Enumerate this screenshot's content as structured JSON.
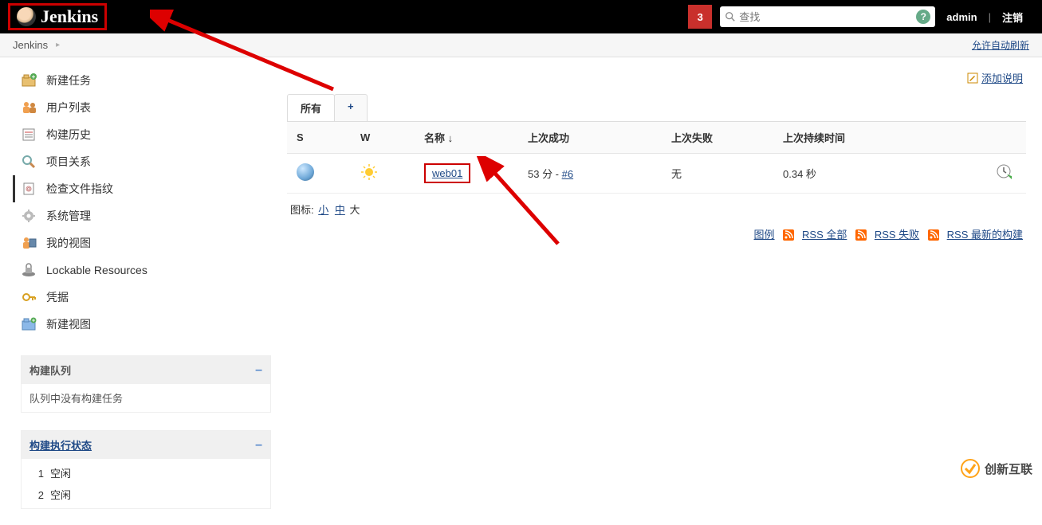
{
  "header": {
    "logo_text": "Jenkins",
    "notification_count": "3",
    "search_placeholder": "查找",
    "username": "admin",
    "logout": "注销"
  },
  "breadcrumb": {
    "root": "Jenkins",
    "auto_refresh": "允许自动刷新"
  },
  "sidebar": {
    "items": [
      {
        "key": "new-item",
        "label": "新建任务"
      },
      {
        "key": "people",
        "label": "用户列表"
      },
      {
        "key": "build-history",
        "label": "构建历史"
      },
      {
        "key": "project-rel",
        "label": "项目关系"
      },
      {
        "key": "fingerprint",
        "label": "检查文件指纹"
      },
      {
        "key": "manage",
        "label": "系统管理"
      },
      {
        "key": "my-views",
        "label": "我的视图"
      },
      {
        "key": "lockable",
        "label": "Lockable Resources"
      },
      {
        "key": "credentials",
        "label": "凭据"
      },
      {
        "key": "new-view",
        "label": "新建视图"
      }
    ],
    "queue": {
      "title": "构建队列",
      "empty_text": "队列中没有构建任务"
    },
    "executors": {
      "title": "构建执行状态",
      "rows": [
        {
          "num": "1",
          "status": "空闲"
        },
        {
          "num": "2",
          "status": "空闲"
        }
      ]
    }
  },
  "content": {
    "add_description": "添加说明",
    "tabs": {
      "all": "所有",
      "add": "+"
    },
    "table": {
      "headers": {
        "s": "S",
        "w": "W",
        "name": "名称 ↓",
        "last_success": "上次成功",
        "last_failure": "上次失败",
        "last_duration": "上次持续时间"
      },
      "rows": [
        {
          "name": "web01",
          "last_success_prefix": "53 分 - ",
          "last_success_build": "#6",
          "last_failure": "无",
          "last_duration": "0.34 秒"
        }
      ]
    },
    "icon_legend": {
      "prefix": "图标: ",
      "small": "小",
      "medium": "中",
      "large": "大"
    },
    "feeds": {
      "legend": "图例",
      "rss_all": "RSS 全部",
      "rss_fail": "RSS 失败",
      "rss_latest": "RSS 最新的构建"
    }
  },
  "watermark": "创新互联"
}
